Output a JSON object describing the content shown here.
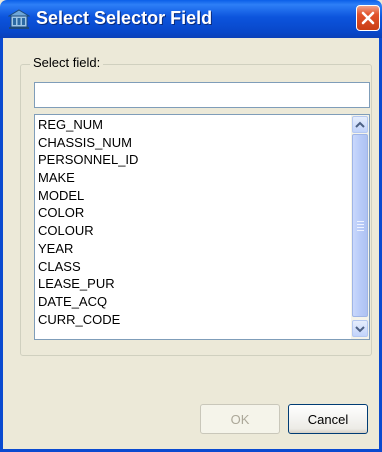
{
  "window": {
    "title": "Select Selector Field"
  },
  "fieldset": {
    "legend": "Select field:"
  },
  "search": {
    "value": ""
  },
  "fields": [
    "REG_NUM",
    "CHASSIS_NUM",
    "PERSONNEL_ID",
    "MAKE",
    "MODEL",
    "COLOR",
    "COLOUR",
    "YEAR",
    "CLASS",
    "LEASE_PUR",
    "DATE_ACQ",
    "CURR_CODE"
  ],
  "buttons": {
    "ok": "OK",
    "cancel": "Cancel",
    "ok_enabled": false
  },
  "colors": {
    "titlebar": "#0a5fe8",
    "close": "#e2532b",
    "dialog_bg": "#ece9d8",
    "border": "#7f9db9"
  }
}
